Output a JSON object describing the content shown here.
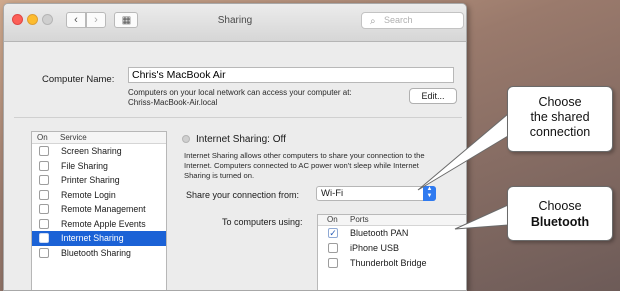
{
  "window": {
    "title": "Sharing",
    "search_placeholder": "Search",
    "grid_glyph": "▦"
  },
  "computer_name": {
    "label": "Computer Name:",
    "value": "Chris's MacBook Air",
    "help_line1": "Computers on your local network can access your computer at:",
    "help_line2": "Chriss-MacBook-Air.local",
    "edit_label": "Edit..."
  },
  "services": {
    "col_on": "On",
    "col_service": "Service",
    "items": [
      {
        "label": "Screen Sharing",
        "on": false,
        "selected": false
      },
      {
        "label": "File Sharing",
        "on": false,
        "selected": false
      },
      {
        "label": "Printer Sharing",
        "on": false,
        "selected": false
      },
      {
        "label": "Remote Login",
        "on": false,
        "selected": false
      },
      {
        "label": "Remote Management",
        "on": false,
        "selected": false
      },
      {
        "label": "Remote Apple Events",
        "on": false,
        "selected": false
      },
      {
        "label": "Internet Sharing",
        "on": false,
        "selected": true
      },
      {
        "label": "Bluetooth Sharing",
        "on": false,
        "selected": false
      }
    ]
  },
  "internet_sharing": {
    "title": "Internet Sharing: Off",
    "desc_line1": "Internet Sharing allows other computers to share your connection to the",
    "desc_line2": "Internet. Computers connected to AC power won't sleep while Internet",
    "desc_line3": "Sharing is turned on.",
    "share_from_label": "Share your connection from:",
    "share_from_value": "Wi-Fi",
    "to_computers_label": "To computers using:",
    "ports_col_on": "On",
    "ports_col_ports": "Ports",
    "ports": [
      {
        "label": "Bluetooth PAN",
        "on": true
      },
      {
        "label": "iPhone USB",
        "on": false
      },
      {
        "label": "Thunderbolt Bridge",
        "on": false
      }
    ]
  },
  "callouts": {
    "shared_line1": "Choose",
    "shared_line2": "the shared",
    "shared_line3": "connection",
    "bt_line1": "Choose",
    "bt_line2": "Bluetooth"
  },
  "colors": {
    "selection": "#1b62d6",
    "popup_arrow": "#2f7af0"
  }
}
